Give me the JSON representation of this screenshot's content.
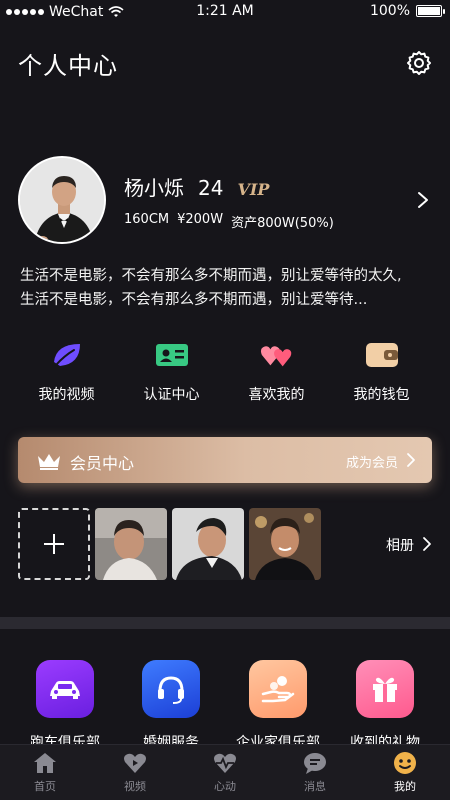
{
  "status_bar": {
    "carrier": "WeChat",
    "time": "1:21 AM",
    "battery": "100%"
  },
  "header": {
    "title": "个人中心",
    "settings_icon": "gear-icon"
  },
  "profile": {
    "name": "杨小烁",
    "age": "24",
    "vip_badge": "VIP",
    "height": "160CM",
    "income": "¥200W",
    "assets": "资产800W(50%)",
    "bio_line1": "生活不是电影，不会有那么多不期而遇，别让爱等待的太久,",
    "bio_line2": "生活不是电影，不会有那么多不期而遇，别让爱等待..."
  },
  "quick_actions": [
    {
      "label": "我的视频",
      "icon": "video-leaf-icon",
      "color": "#7b5cff"
    },
    {
      "label": "认证中心",
      "icon": "id-card-icon",
      "color": "#3fd08a"
    },
    {
      "label": "喜欢我的",
      "icon": "hearts-icon",
      "color": "#ff6f8a"
    },
    {
      "label": "我的钱包",
      "icon": "wallet-icon",
      "color": "#f0c79e"
    }
  ],
  "member": {
    "title": "会员中心",
    "action": "成为会员"
  },
  "album": {
    "label": "相册"
  },
  "services": [
    {
      "label": "跑车俱乐部",
      "icon": "car-icon"
    },
    {
      "label": "婚姻服务",
      "icon": "headset-icon"
    },
    {
      "label": "企业家俱乐部",
      "icon": "hand-coins-icon"
    },
    {
      "label": "收到的礼物",
      "icon": "gift-icon"
    }
  ],
  "tabbar": [
    {
      "label": "首页",
      "icon": "home-icon"
    },
    {
      "label": "视频",
      "icon": "video-heart-icon"
    },
    {
      "label": "心动",
      "icon": "heartbeat-icon"
    },
    {
      "label": "消息",
      "icon": "message-icon"
    },
    {
      "label": "我的",
      "icon": "profile-icon",
      "active": true
    }
  ],
  "colors": {
    "background": "#16151a",
    "vip_gold": "#d6b48b",
    "member_gradient_start": "#b58a6e",
    "member_gradient_end": "#e4c8b1",
    "tab_active": "#f0b24a"
  }
}
